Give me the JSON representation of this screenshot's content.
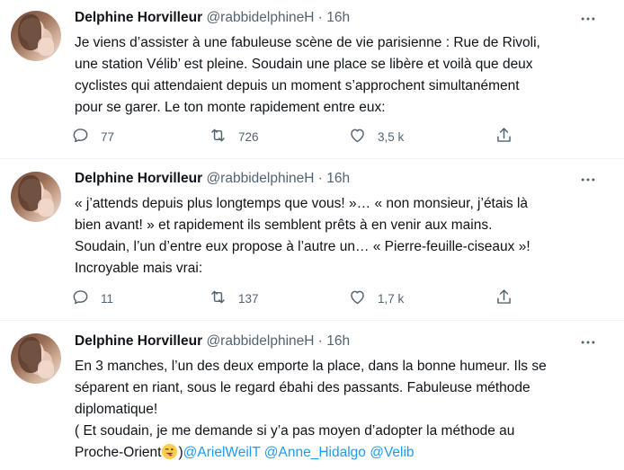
{
  "tweets": [
    {
      "author": {
        "name": "Delphine Horvilleur",
        "handle": "@rabbidelphineH"
      },
      "separator": "·",
      "time": "16h",
      "text": "Je viens d’assister à une fabuleuse scène de vie parisienne : Rue de Rivoli,\nune station Vélib’ est pleine. Soudain une place se libère et voilà que deux\ncyclistes qui attendaient depuis un moment s’approchent simultanément\npour se garer. Le ton monte rapidement entre eux:",
      "metrics": {
        "replies": "77",
        "retweets": "726",
        "likes": "3,5 k"
      }
    },
    {
      "author": {
        "name": "Delphine Horvilleur",
        "handle": "@rabbidelphineH"
      },
      "separator": "·",
      "time": "16h",
      "text": "« j’attends depuis plus longtemps que vous! »… « non monsieur, j’étais là\nbien avant! » et rapidement ils semblent prêts à en venir aux mains.\nSoudain, l’un d’entre eux propose à l’autre un… « Pierre-feuille-ciseaux »!\nIncroyable mais vrai:",
      "metrics": {
        "replies": "11",
        "retweets": "137",
        "likes": "1,7 k"
      }
    },
    {
      "author": {
        "name": "Delphine Horvilleur",
        "handle": "@rabbidelphineH"
      },
      "separator": "·",
      "time": "16h",
      "text": "En 3 manches, l’un des deux emporte la place, dans la bonne humeur. Ils se\nséparent en riant, sous le regard ébahi des passants. Fabuleuse méthode\ndiplomatique!\n( Et soudain, je me demande si y’a pas moyen d’adopter la méthode au\nProche-Orient",
      "text_tail": ")",
      "mentions": [
        "@ArielWeilT",
        "@Anne_Hidalgo",
        "@Velib"
      ],
      "emoji": "winking-face-with-tongue"
    }
  ],
  "colors": {
    "accent": "#1d9bf0",
    "muted": "#536471",
    "text": "#0f1419"
  }
}
